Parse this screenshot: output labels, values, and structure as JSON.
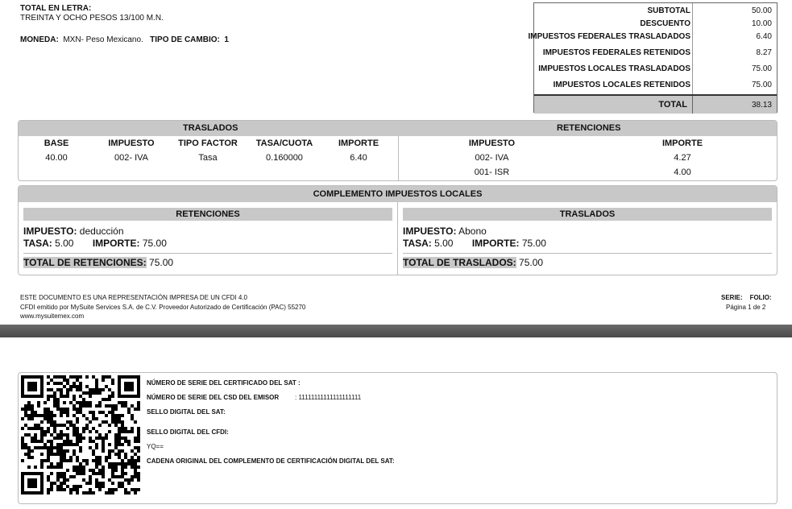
{
  "header": {
    "total_letra_label": "TOTAL EN LETRA:",
    "total_letra_value": "TREINTA Y OCHO PESOS 13/100 M.N.",
    "moneda_label": "MONEDA:",
    "moneda_value": "MXN- Peso Mexicano.",
    "tipo_cambio_label": "TIPO DE CAMBIO:",
    "tipo_cambio_value": "1"
  },
  "totals": {
    "rows": [
      {
        "label": "SUBTOTAL",
        "value": "50.00"
      },
      {
        "label": "DESCUENTO",
        "value": "10.00"
      },
      {
        "label": "IMPUESTOS FEDERALES TRASLADADOS",
        "value": "6.40"
      },
      {
        "label": "IMPUESTOS FEDERALES RETENIDOS",
        "value": "8.27"
      },
      {
        "label": "IMPUESTOS LOCALES  TRASLADADOS",
        "value": "75.00"
      },
      {
        "label": "IMPUESTOS LOCALES RETENIDOS",
        "value": "75.00"
      }
    ],
    "total_label": "TOTAL",
    "total_value": "38.13"
  },
  "traslados": {
    "title": "TRASLADOS",
    "headers": [
      "BASE",
      "IMPUESTO",
      "TIPO FACTOR",
      "TASA/CUOTA",
      "IMPORTE"
    ],
    "row": [
      "40.00",
      "002- IVA",
      "Tasa",
      "0.160000",
      "6.40"
    ]
  },
  "retenciones": {
    "title": "RETENCIONES",
    "headers": [
      "IMPUESTO",
      "IMPORTE"
    ],
    "rows": [
      [
        "002- IVA",
        "4.27"
      ],
      [
        "001- ISR",
        "4.00"
      ]
    ]
  },
  "complemento": {
    "title": "COMPLEMENTO IMPUESTOS LOCALES",
    "retenciones": {
      "title": "RETENCIONES",
      "impuesto_label": "IMPUESTO:",
      "impuesto_value": "deducción",
      "tasa_label": "TASA:",
      "tasa_value": "5.00",
      "importe_label": "IMPORTE:",
      "importe_value": "75.00",
      "total_label": "TOTAL DE RETENCIONES:",
      "total_value": "75.00"
    },
    "traslados": {
      "title": "TRASLADOS",
      "impuesto_label": "IMPUESTO:",
      "impuesto_value": "Abono",
      "tasa_label": "TASA:",
      "tasa_value": "5.00",
      "importe_label": "IMPORTE:",
      "importe_value": "75.00",
      "total_label": "TOTAL DE TRASLADOS:",
      "total_value": "75.00"
    }
  },
  "footer": {
    "line1": "ESTE DOCUMENTO ES UNA REPRESENTACIÓN IMPRESA DE UN CFDI 4.0",
    "line2": "CFDI emitido por MySuite Services S.A. de C.V. Proveedor Autorizado de Certificación (PAC) 55270",
    "line3": "www.mysuitemex.com",
    "serie_label": "SERIE:",
    "folio_label": "FOLIO:",
    "pagina": "Página  1  de  2"
  },
  "sat": {
    "cert_sat_label": "NÚMERO DE SERIE DEL CERTIFICADO DEL SAT :",
    "csd_label": "NÚMERO DE SERIE DEL CSD DEL EMISOR",
    "csd_value": ": 11111111111111111111",
    "sello_sat_label": "SELLO DIGITAL DEL SAT:",
    "sello_cfdi_label": "SELLO DIGITAL DEL CFDI:",
    "sello_cfdi_value": "YQ==",
    "cadena_label": "CADENA ORIGINAL DEL COMPLEMENTO DE CERTIFICACIÓN DIGITAL DEL SAT:"
  }
}
